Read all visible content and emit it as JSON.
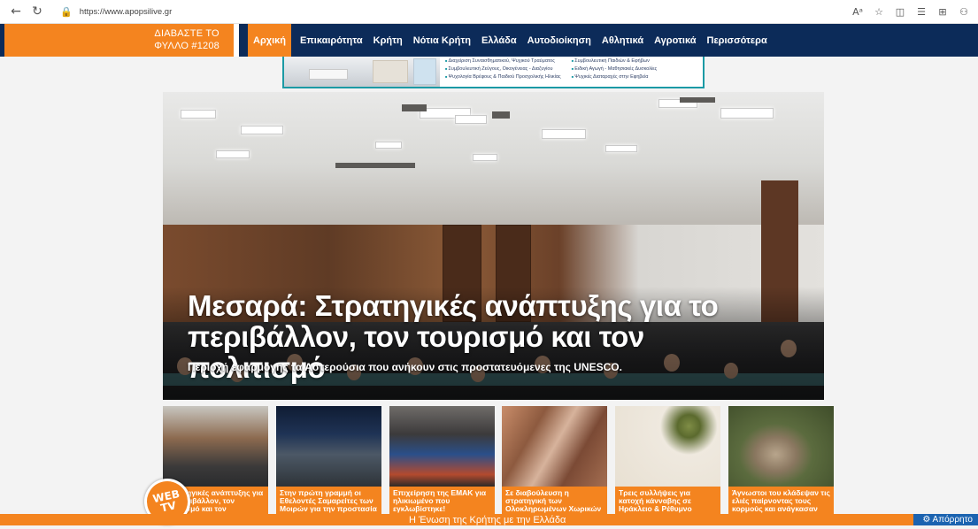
{
  "browser": {
    "url": "https://www.apopsilive.gr",
    "icons": [
      "back-icon",
      "refresh-icon",
      "lock-icon",
      "read-aloud-icon",
      "favorite-icon",
      "split-screen-icon",
      "favorites-bar-icon",
      "collections-icon",
      "extensions-icon"
    ]
  },
  "header": {
    "paper_promo_line1": "ΔΙΑΒΑΣΤΕ ΤΟ",
    "paper_promo_line2": "ΦΥΛΛΟ #1208",
    "nav": [
      "Αρχική",
      "Επικαιρότητα",
      "Κρήτη",
      "Νότια Κρήτη",
      "Ελλάδα",
      "Αυτοδιοίκηση",
      "Αθλητικά",
      "Αγροτικά",
      "Περισσότερα"
    ],
    "active_nav": "Αρχική"
  },
  "ad": {
    "col1": [
      "Διαχείριση Συναισθηματικού, Ψυχικού Τραύματος",
      "Συμβουλευτική Ζεύγους, Οικογένειας - Διαζυγίου",
      "Ψυχολογία Βρέφους & Παιδιού Προσχολικής Ηλικίας"
    ],
    "col2": [
      "Συμβουλευτική Παιδιών & Εφήβων",
      "Ειδική Αγωγή - Μαθησιακές Δυσκολίες",
      "Ψυχικές Διαταραχές στην Εφηβεία"
    ]
  },
  "hero": {
    "title": "Μεσαρά: Στρατηγικές ανάπτυξης για το περιβάλλον, τον τουρισμό και τον πολιτισμό",
    "subtitle": "Περιοχή εφαρμογής τα Αστερούσια που ανήκουν στις προστατευόμενες της UNESCO."
  },
  "thumbs": [
    {
      "caption": "Στρατηγικές ανάπτυξης για το περιβάλλον, τον τουρισμό και τον"
    },
    {
      "caption": "Στην πρώτη γραμμή οι Εθελοντές Σαμαρείτες των Μοιρών για την προστασία"
    },
    {
      "caption": "Επιχείρηση της ΕΜΑΚ για ηλικιωμένο που εγκλωβίστηκε!"
    },
    {
      "caption": "Σε διαβούλευση η στρατηγική των Ολοκληρωμένων Χωρικών Επενδύσεων για τα"
    },
    {
      "caption": "Τρεις συλλήψεις για κατοχή κάνναβης σε Ηράκλειο & Ρέθυμνο"
    },
    {
      "caption": "Άγνωστοι του κλάδεψαν τις ελιές παίρνοντας τους κορμούς και ανάγκασαν τον"
    }
  ],
  "webtv": {
    "line1": "WEB",
    "line2": "TV"
  },
  "bottom_bar": {
    "text": "Η Ένωση της Κρήτης με την Ελλάδα"
  },
  "privacy": {
    "text": "⚙ Απόρρητο"
  }
}
